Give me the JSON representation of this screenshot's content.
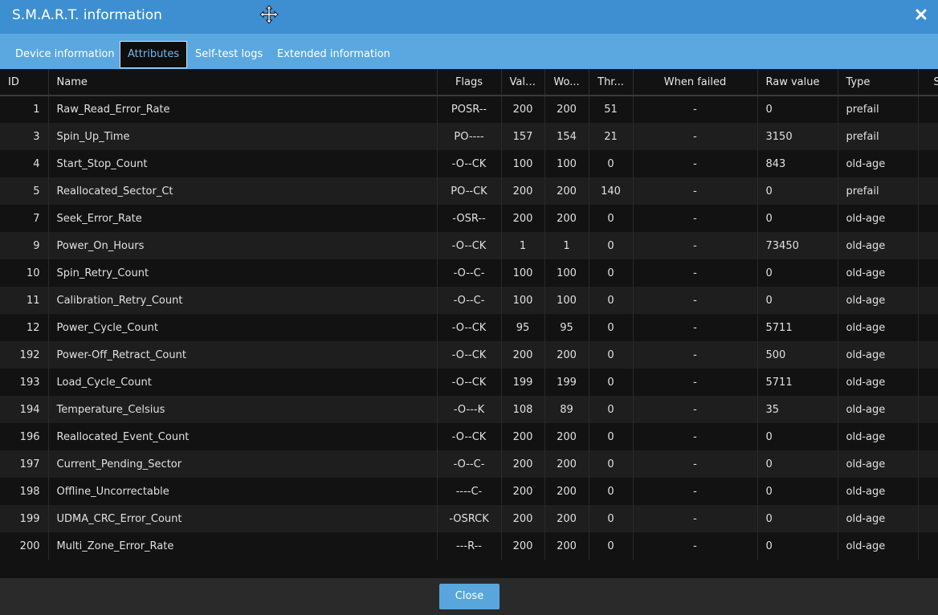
{
  "window": {
    "title": "S.M.A.R.T. information",
    "close_icon": "close-icon",
    "move_icon": "move-cursor-icon"
  },
  "tabs": [
    {
      "label": "Device information",
      "active": false
    },
    {
      "label": "Attributes",
      "active": true
    },
    {
      "label": "Self-test logs",
      "active": false
    },
    {
      "label": "Extended information",
      "active": false
    }
  ],
  "columns": [
    "ID",
    "Name",
    "Flags",
    "Value",
    "Wo...",
    "Thr...",
    "When failed",
    "Raw value",
    "Type",
    "Status"
  ],
  "status_colors": {
    "good": "#5fcf65",
    "neutral": "#e4e4e4"
  },
  "rows": [
    {
      "id": "1",
      "name": "Raw_Read_Error_Rate",
      "flags": "POSR--",
      "value": "200",
      "worst": "200",
      "thresh": "51",
      "when_failed": "-",
      "raw": "0",
      "type": "prefail",
      "status": "good"
    },
    {
      "id": "3",
      "name": "Spin_Up_Time",
      "flags": "PO----",
      "value": "157",
      "worst": "154",
      "thresh": "21",
      "when_failed": "-",
      "raw": "3150",
      "type": "prefail",
      "status": "good"
    },
    {
      "id": "4",
      "name": "Start_Stop_Count",
      "flags": "-O--CK",
      "value": "100",
      "worst": "100",
      "thresh": "0",
      "when_failed": "-",
      "raw": "843",
      "type": "old-age",
      "status": "neutral"
    },
    {
      "id": "5",
      "name": "Reallocated_Sector_Ct",
      "flags": "PO--CK",
      "value": "200",
      "worst": "200",
      "thresh": "140",
      "when_failed": "-",
      "raw": "0",
      "type": "prefail",
      "status": "good"
    },
    {
      "id": "7",
      "name": "Seek_Error_Rate",
      "flags": "-OSR--",
      "value": "200",
      "worst": "200",
      "thresh": "0",
      "when_failed": "-",
      "raw": "0",
      "type": "old-age",
      "status": "neutral"
    },
    {
      "id": "9",
      "name": "Power_On_Hours",
      "flags": "-O--CK",
      "value": "1",
      "worst": "1",
      "thresh": "0",
      "when_failed": "-",
      "raw": "73450",
      "type": "old-age",
      "status": "neutral"
    },
    {
      "id": "10",
      "name": "Spin_Retry_Count",
      "flags": "-O--C-",
      "value": "100",
      "worst": "100",
      "thresh": "0",
      "when_failed": "-",
      "raw": "0",
      "type": "old-age",
      "status": "neutral"
    },
    {
      "id": "11",
      "name": "Calibration_Retry_Count",
      "flags": "-O--C-",
      "value": "100",
      "worst": "100",
      "thresh": "0",
      "when_failed": "-",
      "raw": "0",
      "type": "old-age",
      "status": "neutral"
    },
    {
      "id": "12",
      "name": "Power_Cycle_Count",
      "flags": "-O--CK",
      "value": "95",
      "worst": "95",
      "thresh": "0",
      "when_failed": "-",
      "raw": "5711",
      "type": "old-age",
      "status": "neutral"
    },
    {
      "id": "192",
      "name": "Power-Off_Retract_Count",
      "flags": "-O--CK",
      "value": "200",
      "worst": "200",
      "thresh": "0",
      "when_failed": "-",
      "raw": "500",
      "type": "old-age",
      "status": "neutral"
    },
    {
      "id": "193",
      "name": "Load_Cycle_Count",
      "flags": "-O--CK",
      "value": "199",
      "worst": "199",
      "thresh": "0",
      "when_failed": "-",
      "raw": "5711",
      "type": "old-age",
      "status": "neutral"
    },
    {
      "id": "194",
      "name": "Temperature_Celsius",
      "flags": "-O---K",
      "value": "108",
      "worst": "89",
      "thresh": "0",
      "when_failed": "-",
      "raw": "35",
      "type": "old-age",
      "status": "neutral"
    },
    {
      "id": "196",
      "name": "Reallocated_Event_Count",
      "flags": "-O--CK",
      "value": "200",
      "worst": "200",
      "thresh": "0",
      "when_failed": "-",
      "raw": "0",
      "type": "old-age",
      "status": "neutral"
    },
    {
      "id": "197",
      "name": "Current_Pending_Sector",
      "flags": "-O--C-",
      "value": "200",
      "worst": "200",
      "thresh": "0",
      "when_failed": "-",
      "raw": "0",
      "type": "old-age",
      "status": "neutral"
    },
    {
      "id": "198",
      "name": "Offline_Uncorrectable",
      "flags": "----C-",
      "value": "200",
      "worst": "200",
      "thresh": "0",
      "when_failed": "-",
      "raw": "0",
      "type": "old-age",
      "status": "neutral"
    },
    {
      "id": "199",
      "name": "UDMA_CRC_Error_Count",
      "flags": "-OSRCK",
      "value": "200",
      "worst": "200",
      "thresh": "0",
      "when_failed": "-",
      "raw": "0",
      "type": "old-age",
      "status": "neutral"
    },
    {
      "id": "200",
      "name": "Multi_Zone_Error_Rate",
      "flags": "---R--",
      "value": "200",
      "worst": "200",
      "thresh": "0",
      "when_failed": "-",
      "raw": "0",
      "type": "old-age",
      "status": "neutral"
    }
  ],
  "footer": {
    "close_label": "Close"
  }
}
